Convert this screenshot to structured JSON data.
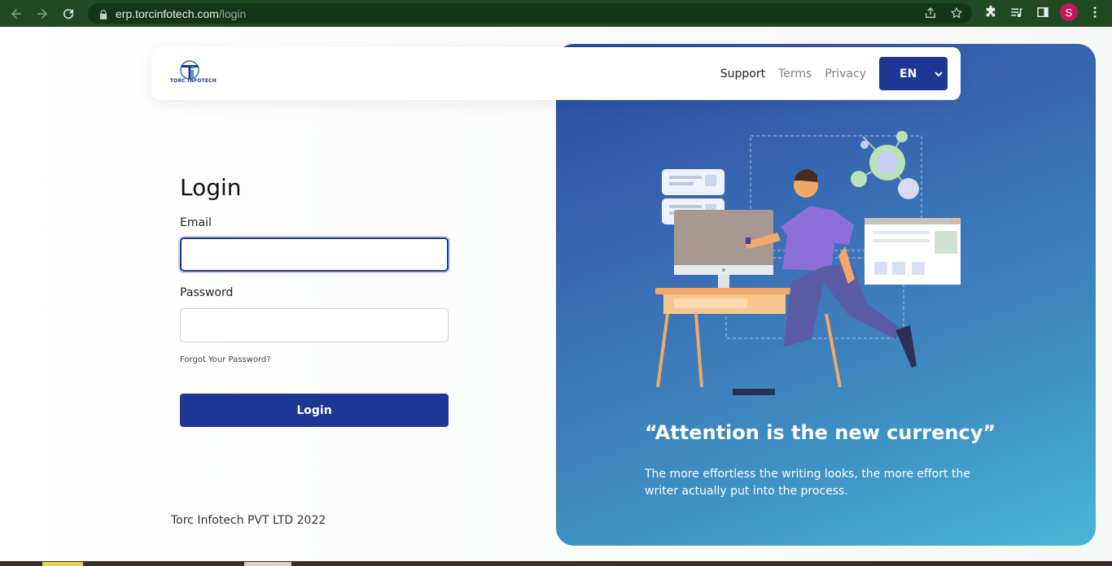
{
  "browser": {
    "url_host": "erp.torcinfotech.com",
    "url_path": "/login",
    "profile_initial": "S",
    "icons": [
      "back-icon",
      "forward-icon",
      "reload-icon",
      "lock-icon",
      "share-icon",
      "star-icon",
      "extensions-icon",
      "media-icon",
      "side-panel-icon",
      "menu-icon"
    ]
  },
  "header": {
    "logo_text": "TORC INFOTECH",
    "nav": {
      "support": "Support",
      "terms": "Terms",
      "privacy": "Privacy"
    },
    "language": "EN"
  },
  "login": {
    "title": "Login",
    "email_label": "Email",
    "email_value": "",
    "password_label": "Password",
    "password_value": "",
    "forgot": "Forgot Your Password?",
    "button": "Login"
  },
  "footer": {
    "text": "Torc Infotech PVT LTD 2022"
  },
  "hero": {
    "quote": "“Attention is the new currency”",
    "subtext": "The more effortless the writing looks, the more effort the writer actually put into the process."
  },
  "colors": {
    "chrome": "#1f4a22",
    "primary": "#1e3794",
    "hero_start": "#2c4aa1",
    "hero_end": "#49b7d6"
  }
}
